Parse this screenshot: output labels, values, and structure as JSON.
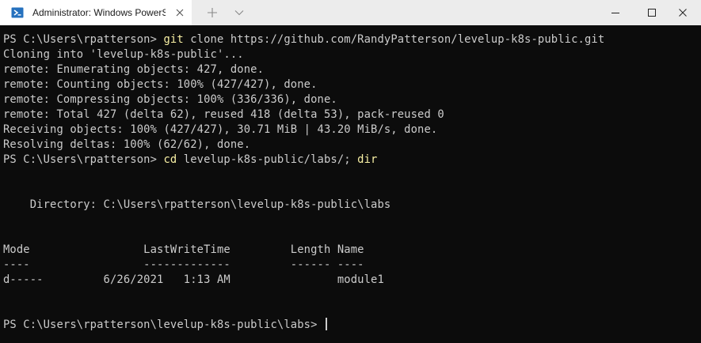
{
  "window": {
    "tab_title": "Administrator: Windows PowerShell",
    "tab_icon": "powershell-icon"
  },
  "colors": {
    "background": "#0c0c0c",
    "text": "#cccccc",
    "command": "#f9f1a5"
  },
  "terminal": {
    "lines": [
      {
        "prompt": "PS C:\\Users\\rpatterson> ",
        "cmd": "git",
        "rest": " clone https://github.com/RandyPatterson/levelup-k8s-public.git"
      },
      {
        "text": "Cloning into 'levelup-k8s-public'..."
      },
      {
        "text": "remote: Enumerating objects: 427, done."
      },
      {
        "text": "remote: Counting objects: 100% (427/427), done."
      },
      {
        "text": "remote: Compressing objects: 100% (336/336), done."
      },
      {
        "text": "remote: Total 427 (delta 62), reused 418 (delta 53), pack-reused 0"
      },
      {
        "text": "Receiving objects: 100% (427/427), 30.71 MiB | 43.20 MiB/s, done."
      },
      {
        "text": "Resolving deltas: 100% (62/62), done."
      },
      {
        "prompt": "PS C:\\Users\\rpatterson> ",
        "cmd": "cd",
        "rest": " levelup-k8s-public/labs/; ",
        "cmd2": "dir"
      },
      {
        "text": ""
      },
      {
        "text": ""
      },
      {
        "text": "    Directory: C:\\Users\\rpatterson\\levelup-k8s-public\\labs"
      },
      {
        "text": ""
      },
      {
        "text": ""
      },
      {
        "text": "Mode                 LastWriteTime         Length Name"
      },
      {
        "text": "----                 -------------         ------ ----"
      },
      {
        "text": "d-----         6/26/2021   1:13 AM                module1"
      },
      {
        "text": ""
      },
      {
        "text": ""
      },
      {
        "prompt": "PS C:\\Users\\rpatterson\\levelup-k8s-public\\labs> ",
        "cursor": true
      }
    ]
  }
}
